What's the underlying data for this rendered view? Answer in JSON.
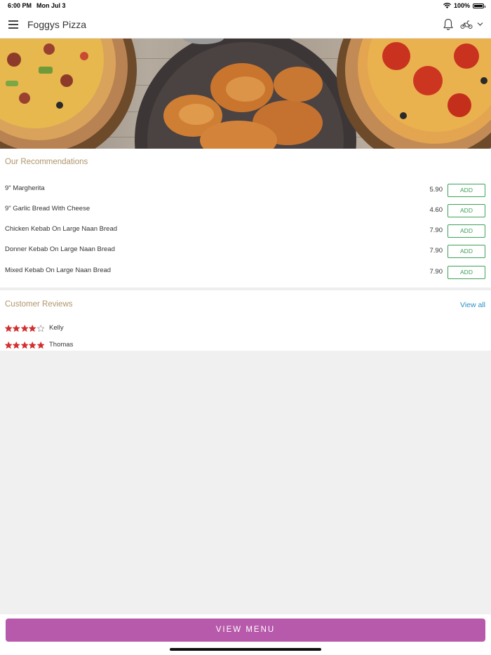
{
  "status_bar": {
    "time": "6:00 PM",
    "date": "Mon Jul 3",
    "battery": "100%",
    "icons": [
      "wifi-icon",
      "battery-icon"
    ]
  },
  "header": {
    "title": "Foggys Pizza",
    "icons": [
      "menu-icon",
      "bell-icon",
      "scooter-icon",
      "chevron-down-icon"
    ]
  },
  "hero": {
    "description": "food-banner-image"
  },
  "recommendations": {
    "title": "Our Recommendations",
    "add_label": "ADD",
    "items": [
      {
        "name": "9\" Margherita",
        "price": "5.90"
      },
      {
        "name": "9\" Garlic Bread With Cheese",
        "price": "4.60"
      },
      {
        "name": "Chicken Kebab On Large Naan Bread",
        "price": "7.90"
      },
      {
        "name": "Donner Kebab On Large Naan Bread",
        "price": "7.90"
      },
      {
        "name": "Mixed Kebab On Large Naan Bread",
        "price": "7.90"
      }
    ]
  },
  "reviews": {
    "title": "Customer Reviews",
    "view_all": "View all",
    "items": [
      {
        "name": "Kelly",
        "rating": 4,
        "max": 5
      },
      {
        "name": "Thomas",
        "rating": 5,
        "max": 5
      }
    ]
  },
  "bottom": {
    "view_menu": "VIEW MENU"
  },
  "colors": {
    "accent": "#b85aab",
    "add_green": "#3ea15a",
    "section_title": "#b0956b",
    "link_blue": "#2b8fc9",
    "star_red": "#d32f2f",
    "background": "#f0f0f0"
  }
}
